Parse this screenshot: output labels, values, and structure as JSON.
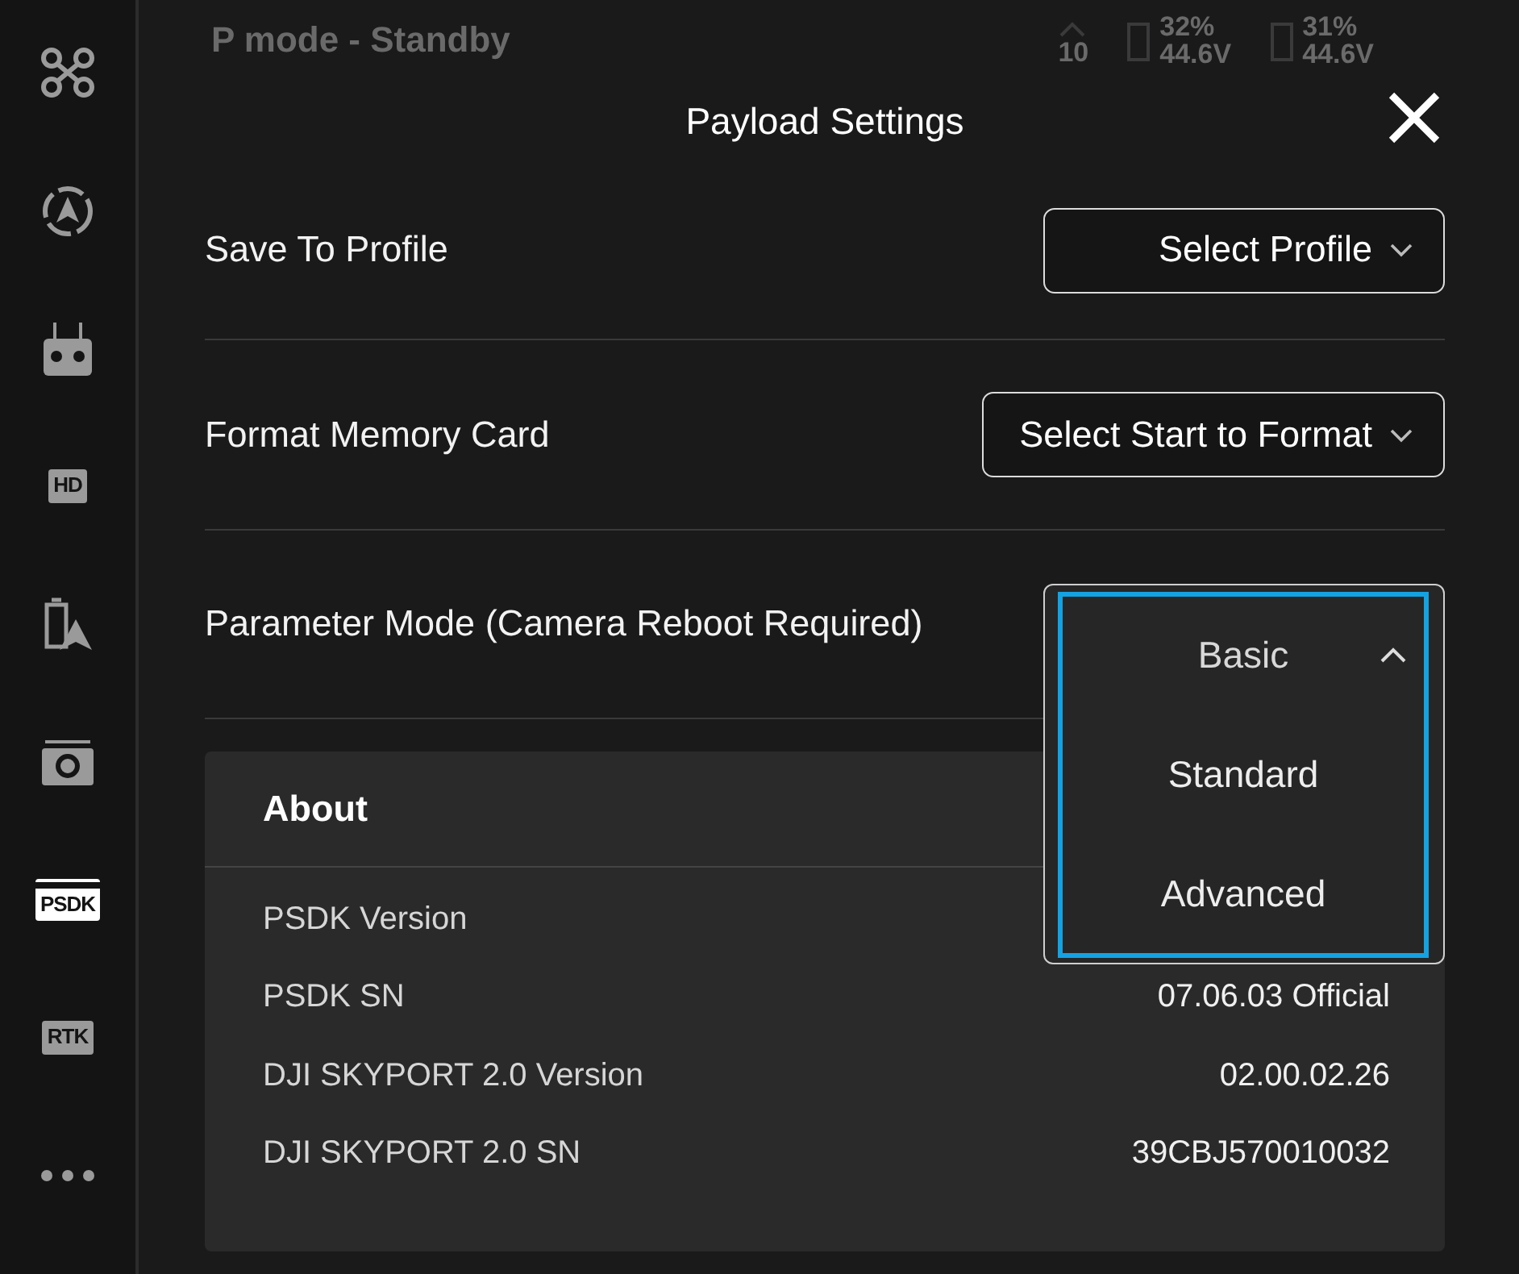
{
  "sidebar": {
    "items": [
      {
        "kind": "drone",
        "selected": false
      },
      {
        "kind": "compass",
        "selected": false
      },
      {
        "kind": "remote",
        "selected": false
      },
      {
        "kind": "tag",
        "label": "HD",
        "selected": false
      },
      {
        "kind": "battery",
        "selected": false
      },
      {
        "kind": "camera",
        "selected": false
      },
      {
        "kind": "tag",
        "label": "PSDK",
        "selected": true
      },
      {
        "kind": "tag",
        "label": "RTK",
        "selected": false
      },
      {
        "kind": "more",
        "selected": false
      }
    ]
  },
  "status_bar": {
    "mode": "P mode - Standby",
    "satellites": "10",
    "batteries": [
      {
        "percent": "32%",
        "voltage": "44.6V"
      },
      {
        "percent": "31%",
        "voltage": "44.6V"
      }
    ]
  },
  "dialog": {
    "title": "Payload Settings",
    "settings": [
      {
        "kind": "select",
        "label": "Save To Profile",
        "value": "Select Profile"
      },
      {
        "kind": "select",
        "label": "Format Memory Card",
        "value": "Select Start to Format"
      },
      {
        "kind": "menu",
        "label": "Parameter Mode (Camera Reboot Required)",
        "expanded": true,
        "options": [
          {
            "label": "Basic",
            "selected": true
          },
          {
            "label": "Standard",
            "selected": false
          },
          {
            "label": "Advanced",
            "selected": false
          }
        ]
      }
    ],
    "about": {
      "title": "About",
      "rows": [
        {
          "label": "PSDK Version",
          "value": ""
        },
        {
          "label": "PSDK SN",
          "value": "07.06.03 Official"
        },
        {
          "label": "DJI SKYPORT 2.0 Version",
          "value": "02.00.02.26"
        },
        {
          "label": "DJI SKYPORT 2.0 SN",
          "value": "39CBJ570010032"
        }
      ]
    }
  }
}
